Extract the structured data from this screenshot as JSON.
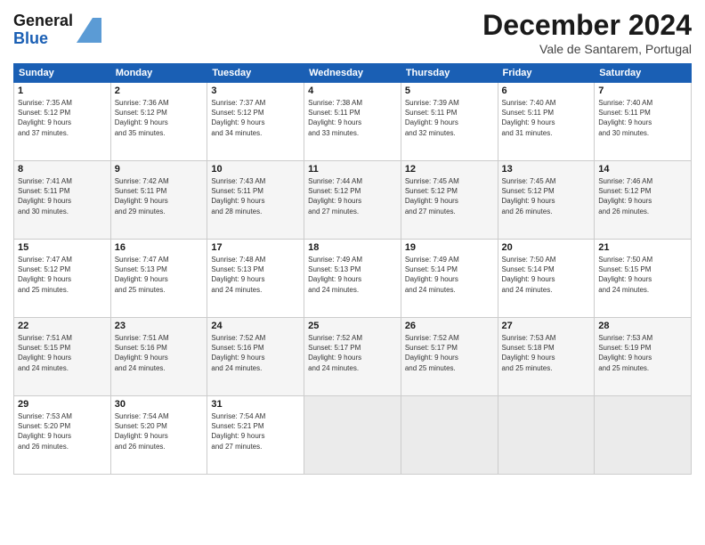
{
  "header": {
    "logo_general": "General",
    "logo_blue": "Blue",
    "title": "December 2024",
    "location": "Vale de Santarem, Portugal"
  },
  "weekdays": [
    "Sunday",
    "Monday",
    "Tuesday",
    "Wednesday",
    "Thursday",
    "Friday",
    "Saturday"
  ],
  "weeks": [
    [
      {
        "day": "1",
        "info": "Sunrise: 7:35 AM\nSunset: 5:12 PM\nDaylight: 9 hours\nand 37 minutes."
      },
      {
        "day": "2",
        "info": "Sunrise: 7:36 AM\nSunset: 5:12 PM\nDaylight: 9 hours\nand 35 minutes."
      },
      {
        "day": "3",
        "info": "Sunrise: 7:37 AM\nSunset: 5:12 PM\nDaylight: 9 hours\nand 34 minutes."
      },
      {
        "day": "4",
        "info": "Sunrise: 7:38 AM\nSunset: 5:11 PM\nDaylight: 9 hours\nand 33 minutes."
      },
      {
        "day": "5",
        "info": "Sunrise: 7:39 AM\nSunset: 5:11 PM\nDaylight: 9 hours\nand 32 minutes."
      },
      {
        "day": "6",
        "info": "Sunrise: 7:40 AM\nSunset: 5:11 PM\nDaylight: 9 hours\nand 31 minutes."
      },
      {
        "day": "7",
        "info": "Sunrise: 7:40 AM\nSunset: 5:11 PM\nDaylight: 9 hours\nand 30 minutes."
      }
    ],
    [
      {
        "day": "8",
        "info": "Sunrise: 7:41 AM\nSunset: 5:11 PM\nDaylight: 9 hours\nand 30 minutes."
      },
      {
        "day": "9",
        "info": "Sunrise: 7:42 AM\nSunset: 5:11 PM\nDaylight: 9 hours\nand 29 minutes."
      },
      {
        "day": "10",
        "info": "Sunrise: 7:43 AM\nSunset: 5:11 PM\nDaylight: 9 hours\nand 28 minutes."
      },
      {
        "day": "11",
        "info": "Sunrise: 7:44 AM\nSunset: 5:12 PM\nDaylight: 9 hours\nand 27 minutes."
      },
      {
        "day": "12",
        "info": "Sunrise: 7:45 AM\nSunset: 5:12 PM\nDaylight: 9 hours\nand 27 minutes."
      },
      {
        "day": "13",
        "info": "Sunrise: 7:45 AM\nSunset: 5:12 PM\nDaylight: 9 hours\nand 26 minutes."
      },
      {
        "day": "14",
        "info": "Sunrise: 7:46 AM\nSunset: 5:12 PM\nDaylight: 9 hours\nand 26 minutes."
      }
    ],
    [
      {
        "day": "15",
        "info": "Sunrise: 7:47 AM\nSunset: 5:12 PM\nDaylight: 9 hours\nand 25 minutes."
      },
      {
        "day": "16",
        "info": "Sunrise: 7:47 AM\nSunset: 5:13 PM\nDaylight: 9 hours\nand 25 minutes."
      },
      {
        "day": "17",
        "info": "Sunrise: 7:48 AM\nSunset: 5:13 PM\nDaylight: 9 hours\nand 24 minutes."
      },
      {
        "day": "18",
        "info": "Sunrise: 7:49 AM\nSunset: 5:13 PM\nDaylight: 9 hours\nand 24 minutes."
      },
      {
        "day": "19",
        "info": "Sunrise: 7:49 AM\nSunset: 5:14 PM\nDaylight: 9 hours\nand 24 minutes."
      },
      {
        "day": "20",
        "info": "Sunrise: 7:50 AM\nSunset: 5:14 PM\nDaylight: 9 hours\nand 24 minutes."
      },
      {
        "day": "21",
        "info": "Sunrise: 7:50 AM\nSunset: 5:15 PM\nDaylight: 9 hours\nand 24 minutes."
      }
    ],
    [
      {
        "day": "22",
        "info": "Sunrise: 7:51 AM\nSunset: 5:15 PM\nDaylight: 9 hours\nand 24 minutes."
      },
      {
        "day": "23",
        "info": "Sunrise: 7:51 AM\nSunset: 5:16 PM\nDaylight: 9 hours\nand 24 minutes."
      },
      {
        "day": "24",
        "info": "Sunrise: 7:52 AM\nSunset: 5:16 PM\nDaylight: 9 hours\nand 24 minutes."
      },
      {
        "day": "25",
        "info": "Sunrise: 7:52 AM\nSunset: 5:17 PM\nDaylight: 9 hours\nand 24 minutes."
      },
      {
        "day": "26",
        "info": "Sunrise: 7:52 AM\nSunset: 5:17 PM\nDaylight: 9 hours\nand 25 minutes."
      },
      {
        "day": "27",
        "info": "Sunrise: 7:53 AM\nSunset: 5:18 PM\nDaylight: 9 hours\nand 25 minutes."
      },
      {
        "day": "28",
        "info": "Sunrise: 7:53 AM\nSunset: 5:19 PM\nDaylight: 9 hours\nand 25 minutes."
      }
    ],
    [
      {
        "day": "29",
        "info": "Sunrise: 7:53 AM\nSunset: 5:20 PM\nDaylight: 9 hours\nand 26 minutes."
      },
      {
        "day": "30",
        "info": "Sunrise: 7:54 AM\nSunset: 5:20 PM\nDaylight: 9 hours\nand 26 minutes."
      },
      {
        "day": "31",
        "info": "Sunrise: 7:54 AM\nSunset: 5:21 PM\nDaylight: 9 hours\nand 27 minutes."
      },
      {
        "day": "",
        "info": ""
      },
      {
        "day": "",
        "info": ""
      },
      {
        "day": "",
        "info": ""
      },
      {
        "day": "",
        "info": ""
      }
    ]
  ]
}
